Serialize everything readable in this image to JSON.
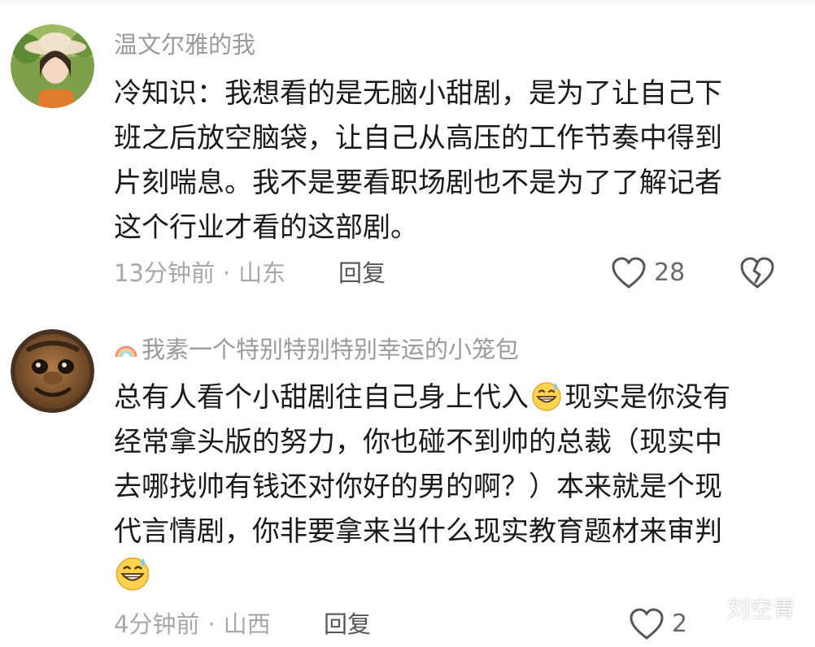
{
  "comments": [
    {
      "username": "温文尔雅的我",
      "lines": [
        "冷知识：我想看的是无脑小甜剧，是为了让自己下",
        "班之后放空脑袋，让自己从高压的工作节奏中得到",
        "片刻喘息。我不是要看职场剧也不是为了了解记者",
        "这个行业才看的这部剧。"
      ],
      "time": "13分钟前",
      "dot": "·",
      "location": "山东",
      "reply_label": "回复",
      "likes": "28"
    },
    {
      "username": "我素一个特别特别特别幸运的小笼包",
      "lines": [
        "总有人看个小甜剧往自己身上代入",
        "现实是你没有",
        "经常拿头版的努力，你也碰不到帅的总裁（现实中",
        "去哪找帅有钱还对你好的男的啊？）本来就是个现",
        "代言情剧，你非要拿来当什么现实教育题材来审判"
      ],
      "time": "4分钟前",
      "dot": "·",
      "location": "山西",
      "reply_label": "回复",
      "likes": "2"
    }
  ],
  "watermark": {
    "text": "刘空青",
    "icon": "wechat-icon"
  },
  "colors": {
    "text": "#1a1a1a",
    "meta": "#a8a8a8",
    "username": "#9a9a9a"
  }
}
